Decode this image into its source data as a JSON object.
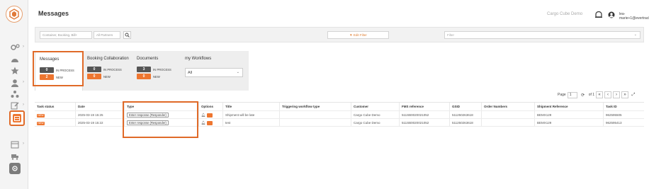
{
  "header": {
    "title": "Messages",
    "company": "Cargo Cube Demo",
    "user_email": "lea-marie+1@evertracker.com"
  },
  "search": {
    "container_placeholder": "Container, Booking, Bill+",
    "partners_placeholder": "All Partners",
    "edit_filter_label": "▼ Edit Filter",
    "filter_placeholder": "Filter"
  },
  "tabs": [
    {
      "label": "Messages",
      "in_process_count": "0",
      "in_process_label": "IN PROCESS",
      "new_count": "2",
      "new_label": "NEW"
    },
    {
      "label": "Booking Collaboration",
      "in_process_count": "0",
      "in_process_label": "IN PROCESS",
      "new_count": "0",
      "new_label": "NEW"
    },
    {
      "label": "Documents",
      "in_process_count": "3",
      "in_process_label": "IN PROCESS",
      "new_count": "0",
      "new_label": "NEW"
    },
    {
      "label": "my Workflows",
      "select_value": "All"
    }
  ],
  "pagination": {
    "page_label": "Page",
    "page_value": "1",
    "of_label": "of 1"
  },
  "table": {
    "columns": [
      "Task status",
      "Date",
      "Type",
      "Options",
      "Title",
      "Triggering workflow type",
      "Customer",
      "FMS reference",
      "GSID",
      "Order Numbers",
      "Shipment Reference",
      "Task ID"
    ],
    "rows": [
      {
        "status": "NEW",
        "date": "2025-03-19 15:25",
        "type": "Enter response (Responder)",
        "title": "Shipment will be late",
        "workflow_type": "",
        "customer": "Cargo Cube Demo",
        "fms": "511SB0020021052",
        "gsid": "511250263618",
        "order": "",
        "shipment_ref": "BEMX129",
        "task_id": "962595505"
      },
      {
        "status": "NEW",
        "date": "2025-03-19 15:22",
        "type": "Enter response (Responder)",
        "title": "test",
        "workflow_type": "",
        "customer": "Cargo Cube Demo",
        "fms": "511SB0020021052",
        "gsid": "511250263618",
        "order": "",
        "shipment_ref": "BEMX129",
        "task_id": "962595413"
      }
    ]
  },
  "colors": {
    "accent": "#ee7630",
    "highlight": "#e06a28",
    "badge_dark": "#555555"
  }
}
